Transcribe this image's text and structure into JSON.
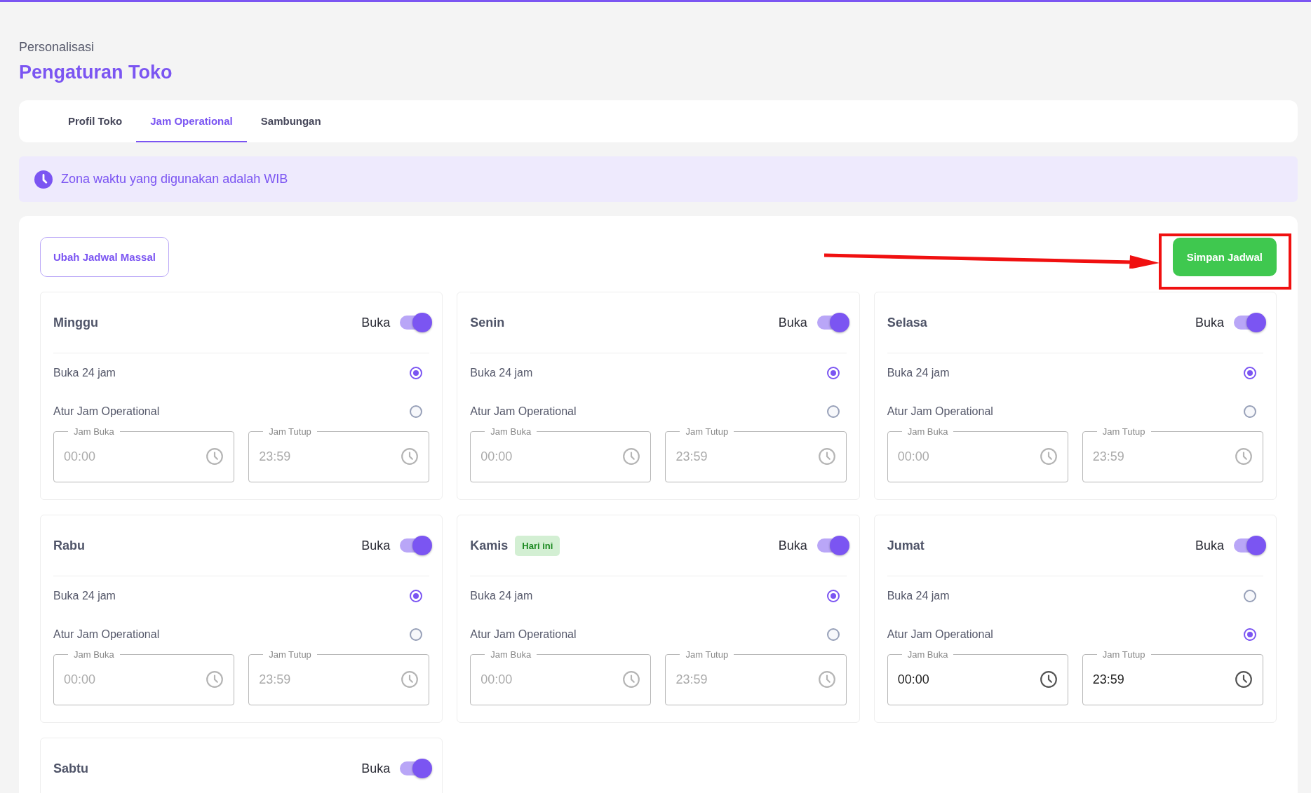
{
  "page": {
    "breadcrumb": "Personalisasi",
    "title": "Pengaturan Toko"
  },
  "tabs": [
    {
      "label": "Profil Toko",
      "selected": false
    },
    {
      "label": "Jam Operational",
      "selected": true
    },
    {
      "label": "Sambungan",
      "selected": false
    }
  ],
  "notice": {
    "text": "Zona waktu yang digunakan adalah WIB"
  },
  "actions": {
    "bulk_button": "Ubah Jadwal Massal",
    "save_button": "Simpan Jadwal"
  },
  "days": [
    {
      "name": "Minggu",
      "status_label": "Buka",
      "open": true,
      "options": [
        {
          "label": "Buka 24 jam",
          "selected": true
        },
        {
          "label": "Atur Jam Operational",
          "selected": false
        }
      ],
      "fields": [
        {
          "label": "Jam Buka",
          "value": "00:00",
          "disabled": true
        },
        {
          "label": "Jam Tutup",
          "value": "23:59",
          "disabled": true
        }
      ]
    },
    {
      "name": "Senin",
      "status_label": "Buka",
      "open": true,
      "options": [
        {
          "label": "Buka 24 jam",
          "selected": true
        },
        {
          "label": "Atur Jam Operational",
          "selected": false
        }
      ],
      "fields": [
        {
          "label": "Jam Buka",
          "value": "00:00",
          "disabled": true
        },
        {
          "label": "Jam Tutup",
          "value": "23:59",
          "disabled": true
        }
      ]
    },
    {
      "name": "Selasa",
      "status_label": "Buka",
      "open": true,
      "options": [
        {
          "label": "Buka 24 jam",
          "selected": true
        },
        {
          "label": "Atur Jam Operational",
          "selected": false
        }
      ],
      "fields": [
        {
          "label": "Jam Buka",
          "value": "00:00",
          "disabled": true
        },
        {
          "label": "Jam Tutup",
          "value": "23:59",
          "disabled": true
        }
      ]
    },
    {
      "name": "Rabu",
      "status_label": "Buka",
      "open": true,
      "options": [
        {
          "label": "Buka 24 jam",
          "selected": true
        },
        {
          "label": "Atur Jam Operational",
          "selected": false
        }
      ],
      "fields": [
        {
          "label": "Jam Buka",
          "value": "00:00",
          "disabled": true
        },
        {
          "label": "Jam Tutup",
          "value": "23:59",
          "disabled": true
        }
      ]
    },
    {
      "name": "Kamis",
      "badge": "Hari ini",
      "status_label": "Buka",
      "open": true,
      "options": [
        {
          "label": "Buka 24 jam",
          "selected": true
        },
        {
          "label": "Atur Jam Operational",
          "selected": false
        }
      ],
      "fields": [
        {
          "label": "Jam Buka",
          "value": "00:00",
          "disabled": true
        },
        {
          "label": "Jam Tutup",
          "value": "23:59",
          "disabled": true
        }
      ]
    },
    {
      "name": "Jumat",
      "status_label": "Buka",
      "open": true,
      "options": [
        {
          "label": "Buka 24 jam",
          "selected": false
        },
        {
          "label": "Atur Jam Operational",
          "selected": true
        }
      ],
      "fields": [
        {
          "label": "Jam Buka",
          "value": "00:00",
          "disabled": false
        },
        {
          "label": "Jam Tutup",
          "value": "23:59",
          "disabled": false
        }
      ]
    },
    {
      "name": "Sabtu",
      "status_label": "Buka",
      "open": true
    }
  ]
}
